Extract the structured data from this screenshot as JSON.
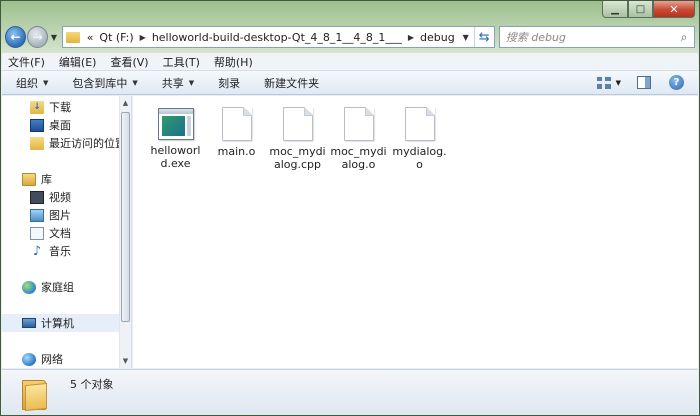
{
  "window": {
    "controls": {
      "minimize": "▁",
      "maximize": "□",
      "close": "✕"
    }
  },
  "address": {
    "overflow": "«",
    "crumbs": [
      "Qt (F:)",
      "helloworld-build-desktop-Qt_4_8_1__4_8_1___",
      "debug"
    ],
    "search_placeholder": "搜索 debug"
  },
  "menu": {
    "items": [
      "文件(F)",
      "编辑(E)",
      "查看(V)",
      "工具(T)",
      "帮助(H)"
    ]
  },
  "commands": {
    "organize": "组织",
    "include_library": "包含到库中",
    "share": "共享",
    "burn": "刻录",
    "new_folder": "新建文件夹"
  },
  "nav": {
    "favorites": [
      {
        "label": "下载",
        "icon": "download-folder-icon"
      },
      {
        "label": "桌面",
        "icon": "desktop-icon"
      },
      {
        "label": "最近访问的位置",
        "icon": "recent-places-icon"
      }
    ],
    "libraries": {
      "label": "库",
      "icon": "library-icon"
    },
    "library_items": [
      {
        "label": "视频",
        "icon": "video-icon"
      },
      {
        "label": "图片",
        "icon": "pictures-icon"
      },
      {
        "label": "文档",
        "icon": "documents-icon"
      },
      {
        "label": "音乐",
        "icon": "music-icon"
      }
    ],
    "homegroup": "家庭组",
    "computer": "计算机",
    "network": "网络"
  },
  "files": [
    {
      "name": "helloworld.exe",
      "type": "exe"
    },
    {
      "name": "main.o",
      "type": "file"
    },
    {
      "name": "moc_mydialog.cpp",
      "type": "file"
    },
    {
      "name": "moc_mydialog.o",
      "type": "file"
    },
    {
      "name": "mydialog.o",
      "type": "file"
    }
  ],
  "status": {
    "count_text": "5 个对象"
  }
}
